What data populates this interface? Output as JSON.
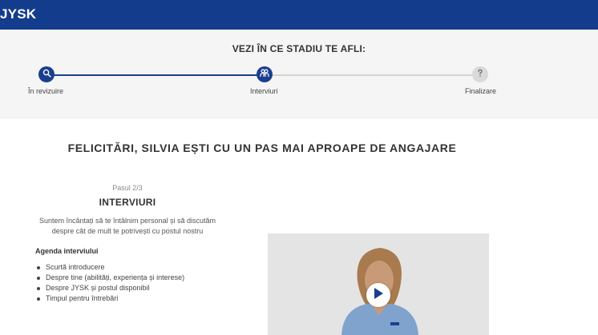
{
  "header": {
    "logo_text": "JYSK",
    "background_color": "#143c8c"
  },
  "progress": {
    "title": "VEZI ÎN CE STADIU TE AFLI:",
    "active_color": "#1b3f8f",
    "steps": [
      {
        "label": "În revizuire",
        "icon": "search-icon",
        "state": "done"
      },
      {
        "label": "Interviuri",
        "icon": "people-icon",
        "state": "current"
      },
      {
        "label": "Finalizare",
        "icon": "question-icon",
        "state": "upcoming"
      }
    ]
  },
  "main": {
    "headline": "FELICITĂRI, SILVIA EȘTI CU UN PAS MAI APROAPE DE ANGAJARE",
    "step_count": "Pasul 2/3",
    "step_heading": "INTERVIURI",
    "intro": "Suntem încântați să te întâlnim personal și să discutăm despre cât de mult te potrivești cu postul nostru",
    "agenda_title": "Agenda interviului",
    "agenda_items": [
      "Scurtă introducere",
      "Despre tine (abilități, experiența și interese)",
      "Despre JYSK și postul disponibil",
      "Timpul pentru întrebări"
    ]
  },
  "video": {
    "play_icon": "play-icon"
  }
}
